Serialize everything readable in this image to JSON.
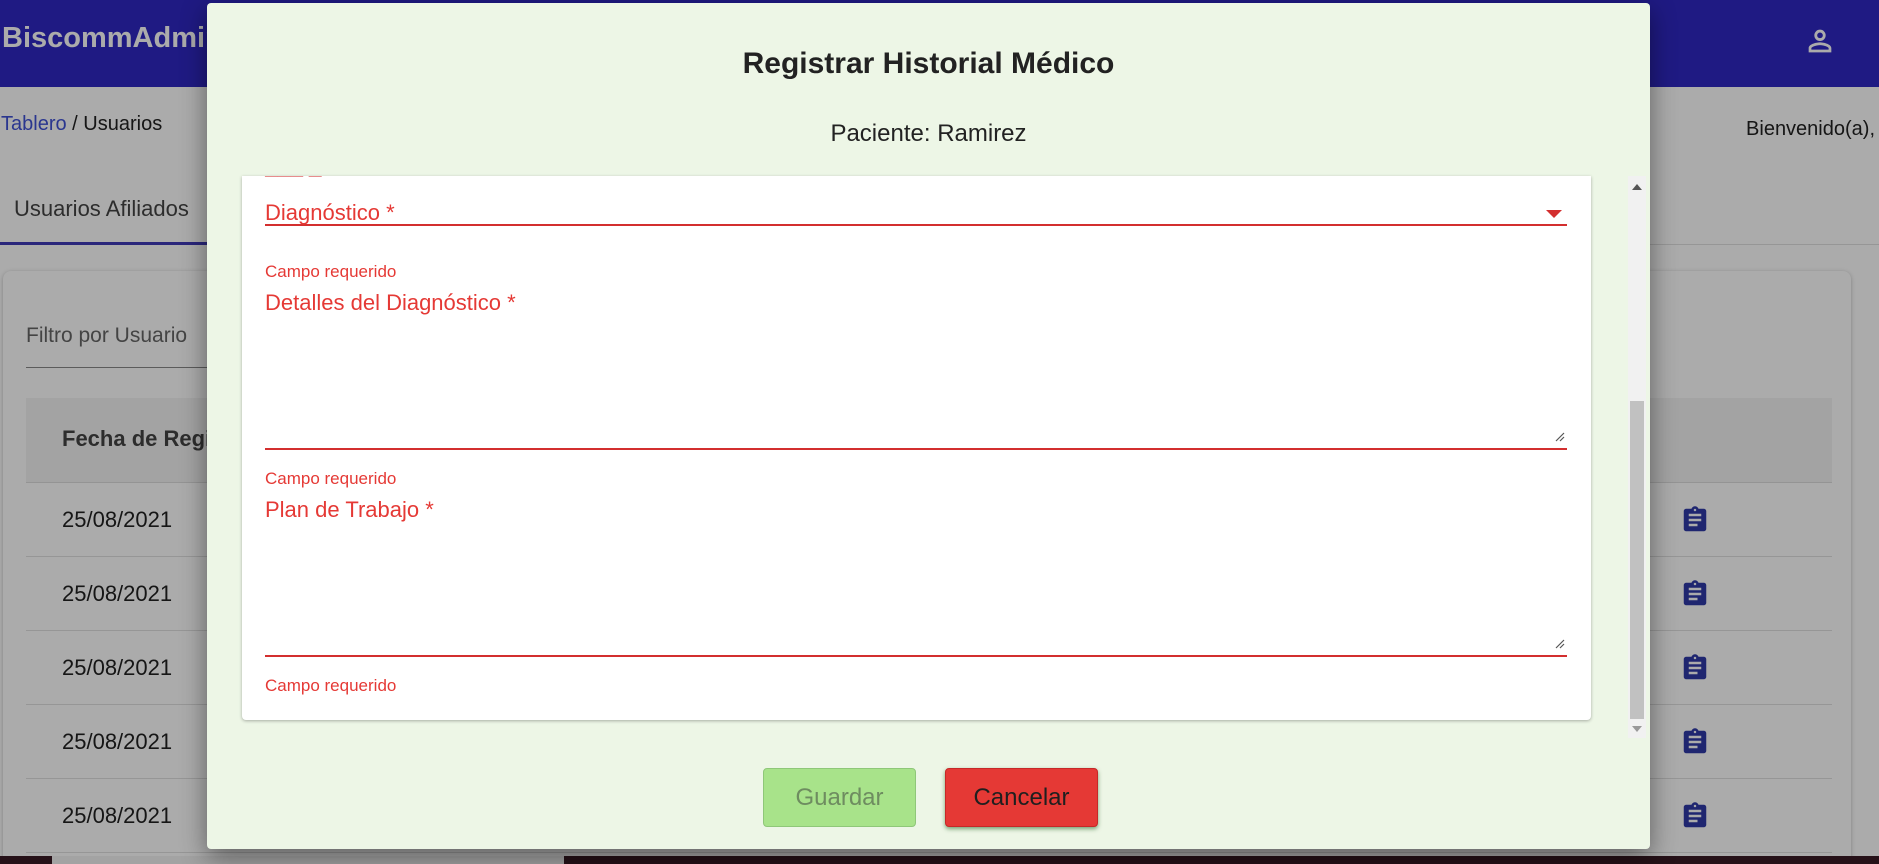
{
  "app": {
    "brand": "BiscommAdmin",
    "breadcrumb": {
      "link": "Tablero",
      "separator": "/",
      "current": "Usuarios"
    },
    "welcome": "Bienvenido(a),",
    "tab": "Usuarios Afiliados",
    "filter_placeholder": "Filtro por Usuario",
    "table_header": "Fecha de Registro",
    "rows": [
      {
        "date": "25/08/2021"
      },
      {
        "date": "25/08/2021"
      },
      {
        "date": "25/08/2021"
      },
      {
        "date": "25/08/2021"
      },
      {
        "date": "25/08/2021"
      }
    ],
    "icons": {
      "account": "account-icon",
      "row_action": "clipboard-icon"
    },
    "colors": {
      "header": "#2f28c4",
      "accent_link": "#3f51d6",
      "row_icon": "#2f3aa8"
    }
  },
  "dialog": {
    "title": "Registrar Historial Médico",
    "subtitle": "Paciente: Ramirez",
    "fields": {
      "diagnostico": {
        "label": "Diagnóstico *",
        "helper": "Campo requerido",
        "value": ""
      },
      "detalles": {
        "label": "Detalles del Diagnóstico *",
        "helper": "Campo requerido",
        "value": ""
      },
      "plan": {
        "label": "Plan de Trabajo *",
        "helper": "Campo requerido",
        "value": ""
      }
    },
    "buttons": {
      "save": "Guardar",
      "cancel": "Cancelar"
    },
    "colors": {
      "background": "#edf6e6",
      "error": "#e53935",
      "save": "#a8e38a",
      "cancel": "#e53935"
    }
  }
}
